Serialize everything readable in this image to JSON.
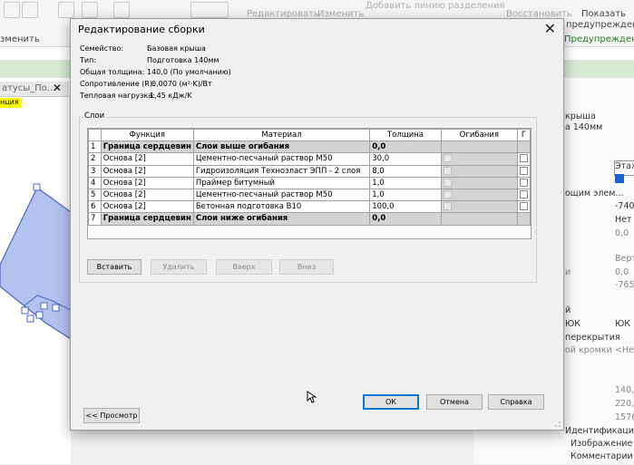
{
  "background": {
    "ribbon": {
      "left_label": "зменить",
      "modify_label": "Редактировать",
      "change_label": "Изменить",
      "divider_label": "Добавить линию разделения",
      "restore_label": "Восстановить",
      "show_label": "Показать",
      "show_label2": "предупреждения",
      "warnings_label": "Предупреждение"
    },
    "view_tab": {
      "label": "атусы_По...",
      "close": "✕",
      "tag": "нция"
    },
    "properties": [
      "крыша",
      "а 140мм",
      "Этаж",
      "ощим элем...",
      "-740,",
      "Нет",
      "0,0",
      "Верт",
      "и",
      "0,0",
      "-765",
      "й",
      "ЮК",
      "ЮК",
      "перекрытия",
      "ой кромки",
      "<Не",
      "140,0",
      "220,7",
      "1576",
      "Идентификация",
      "Изображение",
      "Комментарии"
    ],
    "colors": {
      "ribbon_green": "#d7ead6",
      "shape_fill": "#b3c2ee",
      "shape_stroke": "#4a66c8"
    }
  },
  "dialog": {
    "title": "Редактирование сборки",
    "close_icon": "✕",
    "info": [
      {
        "label": "Семейство:",
        "value": "Базовая крыша"
      },
      {
        "label": "Тип:",
        "value": "Подготовка 140мм"
      },
      {
        "label": "Общая толщина:",
        "value": "140,0 (По умолчанию)"
      },
      {
        "label": "Сопротивление (R):",
        "value": "0,0070 (м²·K)/Вт"
      },
      {
        "label": "Тепловая нагрузка:",
        "value": "1,45 кДж/K"
      }
    ],
    "layers_title": "Слои",
    "columns": [
      "Функция",
      "Материал",
      "Толщина",
      "Огибания",
      "Г"
    ],
    "rows": [
      {
        "n": "1",
        "function": "Граница сердцевин",
        "material": "Слои выше огибания",
        "thickness": "0,0",
        "core": true
      },
      {
        "n": "2",
        "function": "Основа [2]",
        "material": "Цементно-песчаный раствор М50",
        "thickness": "30,0",
        "core": false
      },
      {
        "n": "3",
        "function": "Основа [2]",
        "material": "Гидроизоляция Технозласт ЭПП - 2 слоя",
        "thickness": "8,0",
        "core": false
      },
      {
        "n": "4",
        "function": "Основа [2]",
        "material": "Праймер битумный",
        "thickness": "1,0",
        "core": false
      },
      {
        "n": "5",
        "function": "Основа [2]",
        "material": "Цементно-песчаный раствор М50",
        "thickness": "1,0",
        "core": false
      },
      {
        "n": "6",
        "function": "Основа [2]",
        "material": "Бетонная подготовка В10",
        "thickness": "100,0",
        "core": false
      },
      {
        "n": "7",
        "function": "Граница сердцевин",
        "material": "Слои ниже огибания",
        "thickness": "0,0",
        "core": true
      }
    ],
    "buttons": {
      "insert": "Вставить",
      "delete": "Удалить",
      "up": "Вверх",
      "down": "Вниз",
      "preview": "<< Просмотр",
      "ok": "ОК",
      "cancel": "Отмена",
      "help": "Справка"
    }
  }
}
